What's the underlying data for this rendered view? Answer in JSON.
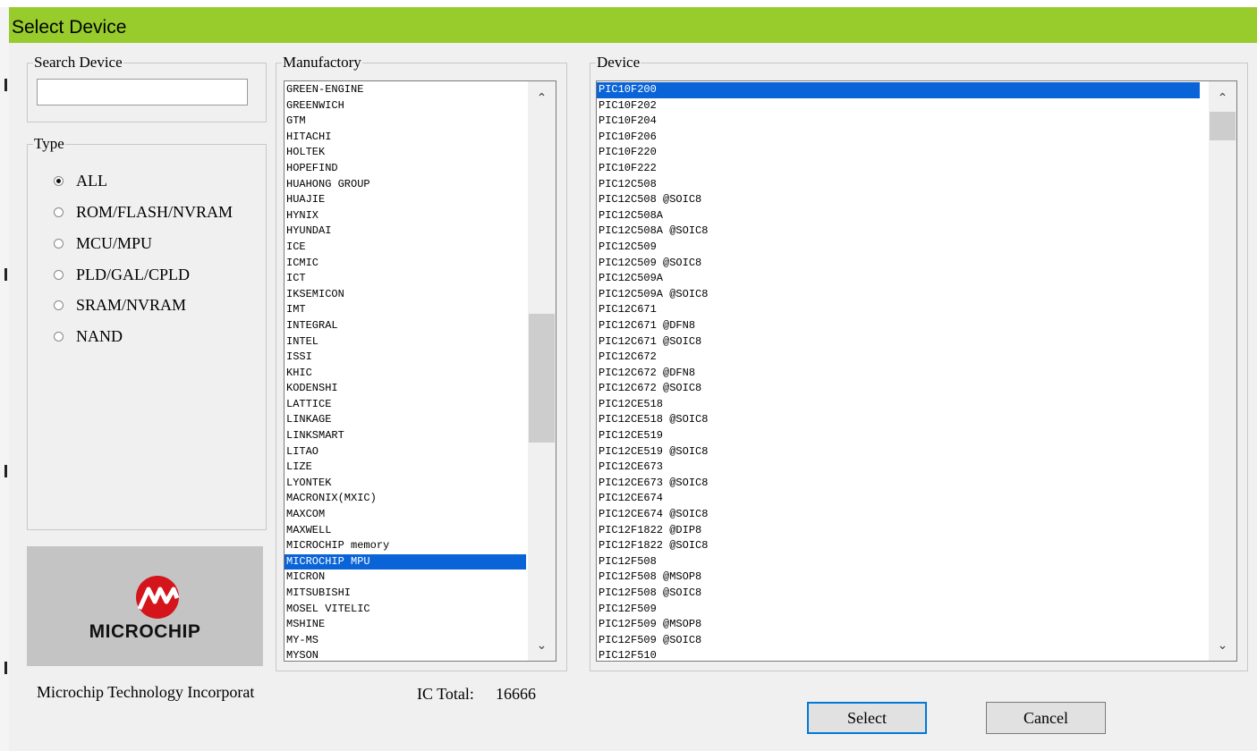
{
  "dialog": {
    "title": "Select Device"
  },
  "search": {
    "legend": "Search Device",
    "value": "",
    "placeholder": ""
  },
  "type": {
    "legend": "Type",
    "options": [
      {
        "label": "ALL",
        "checked": true
      },
      {
        "label": "ROM/FLASH/NVRAM",
        "checked": false
      },
      {
        "label": "MCU/MPU",
        "checked": false
      },
      {
        "label": "PLD/GAL/CPLD",
        "checked": false
      },
      {
        "label": "SRAM/NVRAM",
        "checked": false
      },
      {
        "label": "NAND",
        "checked": false
      }
    ]
  },
  "logo": {
    "name": "microchip-logo",
    "text": "MICROCHIP",
    "color": "#d4151c"
  },
  "manufactory": {
    "legend": "Manufactory",
    "selected": "MICROCHIP MPU",
    "items": [
      "GREEN-ENGINE",
      "GREENWICH",
      "GTM",
      "HITACHI",
      "HOLTEK",
      "HOPEFIND",
      "HUAHONG GROUP",
      "HUAJIE",
      "HYNIX",
      "HYUNDAI",
      "ICE",
      "ICMIC",
      "ICT",
      "IKSEMICON",
      "IMT",
      "INTEGRAL",
      "INTEL",
      "ISSI",
      "KHIC",
      "KODENSHI",
      "LATTICE",
      "LINKAGE",
      "LINKSMART",
      "LITAO",
      "LIZE",
      "LYONTEK",
      "MACRONIX(MXIC)",
      "MAXCOM",
      "MAXWELL",
      "MICROCHIP memory",
      "MICROCHIP MPU",
      "MICRON",
      "MITSUBISHI",
      "MOSEL VITELIC",
      "MSHINE",
      "MY-MS",
      "MYSON"
    ]
  },
  "device": {
    "legend": "Device",
    "selected": "PIC10F200",
    "items": [
      "PIC10F200",
      "PIC10F202",
      "PIC10F204",
      "PIC10F206",
      "PIC10F220",
      "PIC10F222",
      "PIC12C508",
      "PIC12C508 @SOIC8",
      "PIC12C508A",
      "PIC12C508A @SOIC8",
      "PIC12C509",
      "PIC12C509 @SOIC8",
      "PIC12C509A",
      "PIC12C509A @SOIC8",
      "PIC12C671",
      "PIC12C671 @DFN8",
      "PIC12C671 @SOIC8",
      "PIC12C672",
      "PIC12C672 @DFN8",
      "PIC12C672 @SOIC8",
      "PIC12CE518",
      "PIC12CE518 @SOIC8",
      "PIC12CE519",
      "PIC12CE519 @SOIC8",
      "PIC12CE673",
      "PIC12CE673 @SOIC8",
      "PIC12CE674",
      "PIC12CE674 @SOIC8",
      "PIC12F1822 @DIP8",
      "PIC12F1822 @SOIC8",
      "PIC12F508",
      "PIC12F508 @MSOP8",
      "PIC12F508 @SOIC8",
      "PIC12F509",
      "PIC12F509 @MSOP8",
      "PIC12F509 @SOIC8",
      "PIC12F510"
    ]
  },
  "footer": {
    "manufacturer_full_name": "Microchip Technology Incorporat",
    "ic_total_label": "IC Total:",
    "ic_total_value": "16666"
  },
  "buttons": {
    "select": "Select",
    "cancel": "Cancel"
  },
  "colors": {
    "titlebar": "#97cc2c",
    "selection": "#0a64d8"
  }
}
